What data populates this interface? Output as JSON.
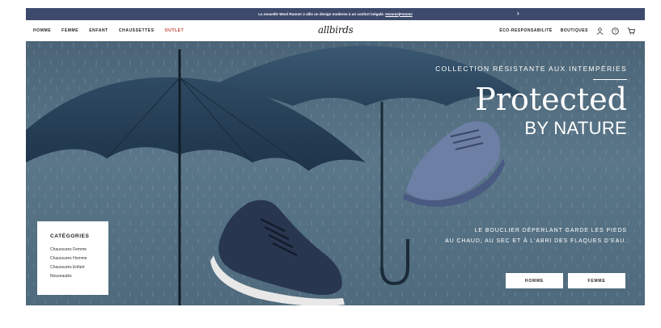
{
  "promo": {
    "text": "La nouvelle Wool Runner 2 allie un design moderne à un confort inégalé.",
    "link_homme": "Homme",
    "separator": "|",
    "link_femme": "Femme",
    "chevron": "›"
  },
  "nav": {
    "left": [
      "HOMME",
      "FEMME",
      "ENFANT",
      "CHAUSSETTES",
      "OUTLET"
    ],
    "logo": "allbirds",
    "right_eco": "ÉCO-RESPONSABILITÉ",
    "right_boutiques": "BOUTIQUES",
    "icons": [
      "user-icon",
      "help-icon",
      "cart-icon"
    ]
  },
  "hero": {
    "eyebrow": "COLLECTION RÉSISTANTE AUX INTEMPÉRIES",
    "headline": "Protected",
    "subhead": "BY NATURE",
    "tagline_line1": "LE BOUCLIER DÉPERLANT GARDE LES PIEDS",
    "tagline_line2": "AU CHAUD, AU SEC ET À L'ABRI DES FLAQUES D'EAU.",
    "cta_homme": "HOMME",
    "cta_femme": "FEMME"
  },
  "categories": {
    "title": "CATÉGORIES",
    "items": [
      "Chaussures Femme",
      "Chaussures Homme",
      "Chaussures Enfant",
      "Nouveautés"
    ]
  },
  "colors": {
    "promo_bg": "#3d4a6b",
    "outlet": "#c43b2a",
    "hero_bg": "#52707f"
  }
}
